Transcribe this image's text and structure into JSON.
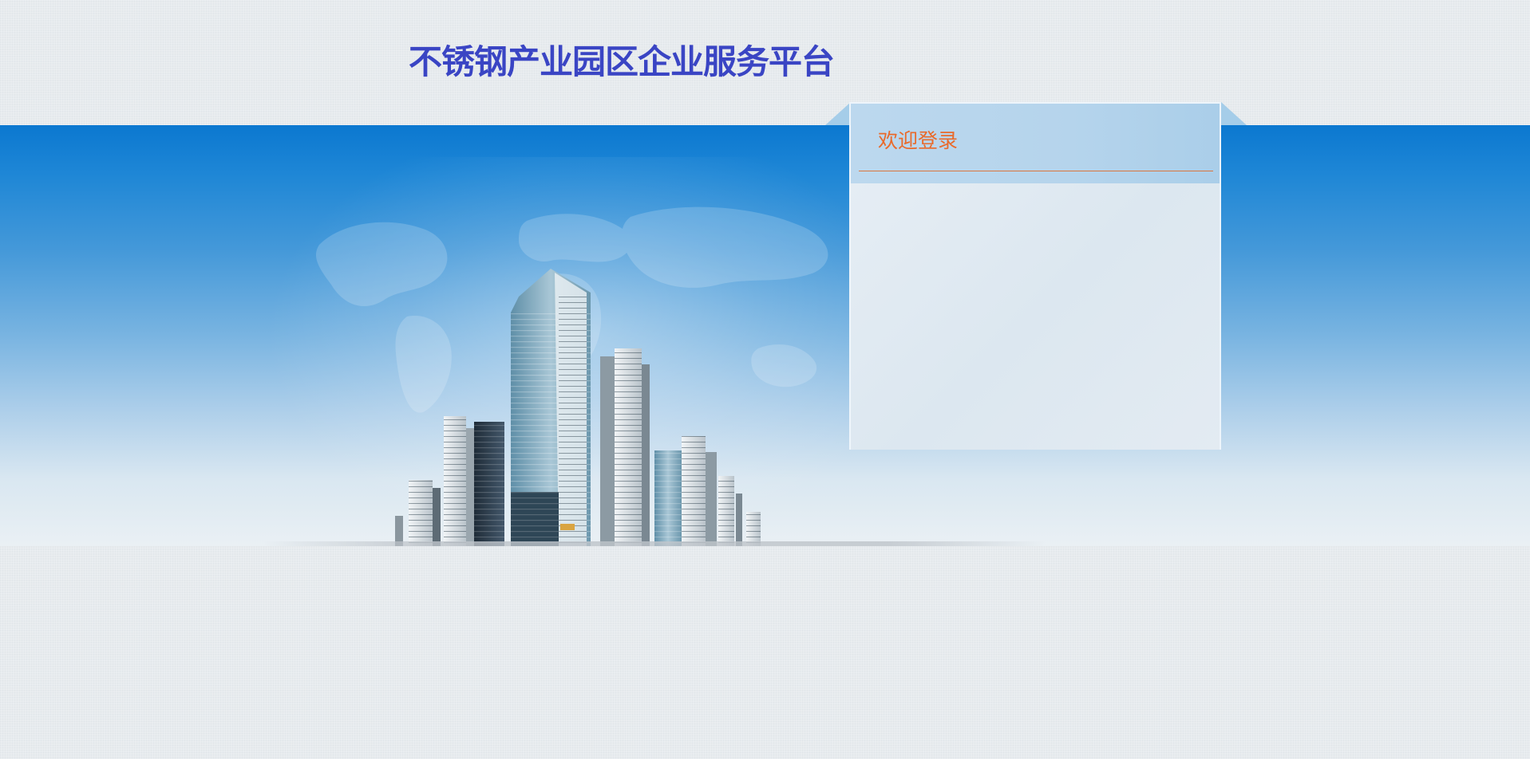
{
  "header": {
    "title": "不锈钢产业园区企业服务平台"
  },
  "login_panel": {
    "welcome": "欢迎登录"
  },
  "colors": {
    "title": "#3a45c4",
    "banner_top": "#0b78d0",
    "welcome_text": "#e96a2b",
    "page_background": "#e7ebee"
  }
}
